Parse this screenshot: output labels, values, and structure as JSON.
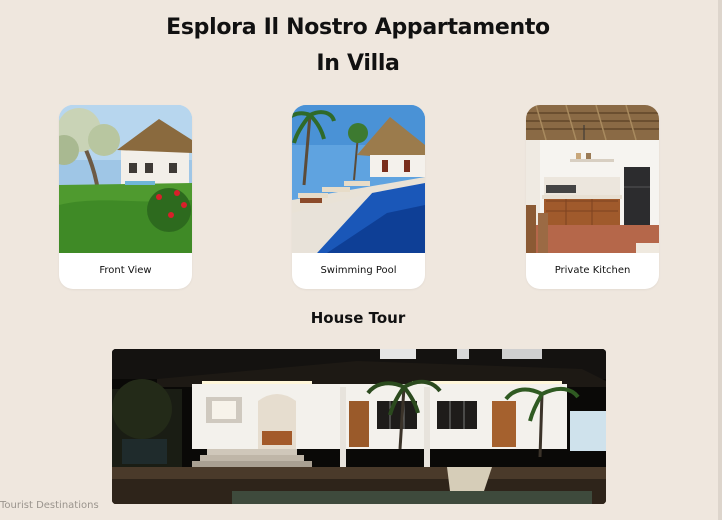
{
  "hero": {
    "title_line1": "Esplora Il Nostro Appartamento",
    "title_line2": "In Villa"
  },
  "gallery": {
    "cards": [
      {
        "caption": "Front View"
      },
      {
        "caption": "Swimming Pool"
      },
      {
        "caption": "Private Kitchen"
      }
    ]
  },
  "house_tour": {
    "title": "House Tour"
  },
  "footer": {
    "label": "Tourist Destinations"
  }
}
